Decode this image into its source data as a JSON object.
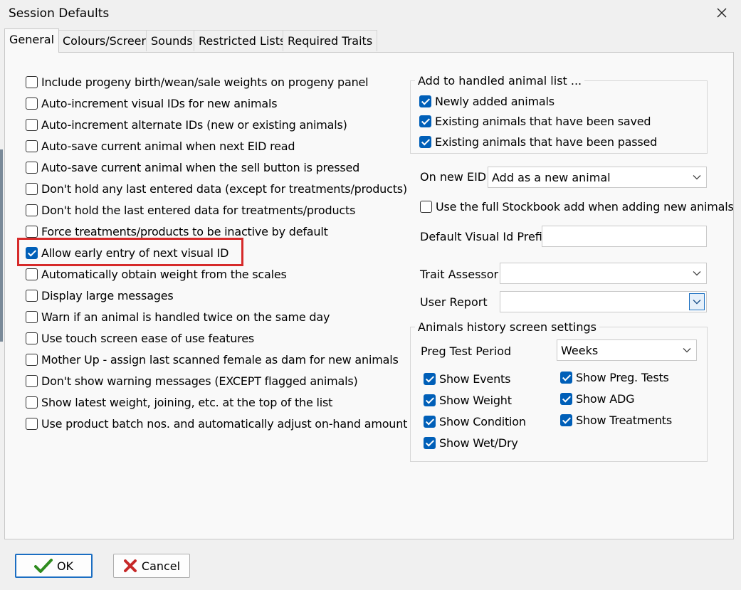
{
  "window": {
    "title": "Session Defaults"
  },
  "tabs": [
    {
      "label": "General",
      "active": true
    },
    {
      "label": "Colours/Screen",
      "active": false
    },
    {
      "label": "Sounds",
      "active": false
    },
    {
      "label": "Restricted Lists",
      "active": false
    },
    {
      "label": "Required Traits",
      "active": false
    }
  ],
  "general": {
    "options": [
      {
        "label": "Include progeny birth/wean/sale weights on progeny panel",
        "checked": false
      },
      {
        "label": "Auto-increment visual IDs for new animals",
        "checked": false
      },
      {
        "label": "Auto-increment alternate IDs (new or existing animals)",
        "checked": false
      },
      {
        "label": "Auto-save current animal when next EID read",
        "checked": false
      },
      {
        "label": "Auto-save current animal when the sell button is pressed",
        "checked": false
      },
      {
        "label": "Don't hold any last entered data (except for treatments/products)",
        "checked": false
      },
      {
        "label": "Don't hold the last entered data for treatments/products",
        "checked": false
      },
      {
        "label": "Force treatments/products to be inactive by default",
        "checked": false
      },
      {
        "label": "Allow early entry of next visual ID",
        "checked": true,
        "highlighted": true
      },
      {
        "label": "Automatically obtain weight from the scales",
        "checked": false
      },
      {
        "label": "Display large messages",
        "checked": false
      },
      {
        "label": "Warn if an animal is handled twice on the same day",
        "checked": false
      },
      {
        "label": "Use touch screen ease of use features",
        "checked": false
      },
      {
        "label": "Mother Up - assign last scanned female as dam for new animals",
        "checked": false
      },
      {
        "label": "Don't show warning messages (EXCEPT flagged animals)",
        "checked": false
      },
      {
        "label": "Show latest weight, joining, etc. at the top of the list",
        "checked": false
      },
      {
        "label": "Use product batch nos. and automatically adjust on-hand amount",
        "checked": false
      }
    ]
  },
  "handled_list": {
    "legend": "Add to handled animal list ...",
    "options": [
      {
        "label": "Newly added animals",
        "checked": true
      },
      {
        "label": "Existing animals that have been saved",
        "checked": true
      },
      {
        "label": "Existing animals that have been passed",
        "checked": true
      }
    ]
  },
  "on_new_eid": {
    "label": "On new EID",
    "value": "Add as a new animal"
  },
  "full_stockbook": {
    "label": "Use the full Stockbook add when adding new animals",
    "checked": false
  },
  "visual_id_prefix": {
    "label": "Default Visual Id Prefix",
    "value": ""
  },
  "trait_assessor": {
    "label": "Trait Assessor",
    "value": ""
  },
  "user_report": {
    "label": "User Report",
    "value": ""
  },
  "history": {
    "legend": "Animals history screen settings",
    "preg_test_period": {
      "label": "Preg Test Period",
      "value": "Weeks"
    },
    "left_options": [
      {
        "label": "Show Events",
        "checked": true
      },
      {
        "label": "Show Weight",
        "checked": true
      },
      {
        "label": "Show Condition",
        "checked": true
      },
      {
        "label": "Show Wet/Dry",
        "checked": true
      }
    ],
    "right_options": [
      {
        "label": "Show Preg. Tests",
        "checked": true
      },
      {
        "label": "Show ADG",
        "checked": true
      },
      {
        "label": "Show Treatments",
        "checked": true
      }
    ]
  },
  "buttons": {
    "ok": "OK",
    "cancel": "Cancel"
  },
  "colors": {
    "accent": "#005fb8",
    "highlight": "#d62a2a",
    "ok_check": "#2e8b1e",
    "cancel_x": "#c62828"
  }
}
